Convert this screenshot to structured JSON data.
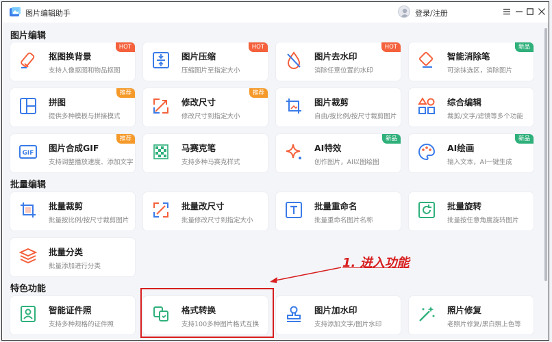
{
  "app": {
    "title": "图片编辑助手",
    "login_label": "登录/注册"
  },
  "colors": {
    "accent": "#3a7be8",
    "hot": "#f4613c",
    "recommend": "#f59a2a",
    "new": "#2fb07b",
    "annotation": "#d81e1e"
  },
  "sections": [
    {
      "title": "图片编辑",
      "cards": [
        {
          "name": "抠图换背景",
          "desc": "支持人像抠图和物品抠图",
          "badge": "HOT",
          "badge_type": "hot",
          "icon": "eraser-icon"
        },
        {
          "name": "图片压缩",
          "desc": "压缩图片至指定大小",
          "badge": "HOT",
          "badge_type": "hot",
          "icon": "compress-icon"
        },
        {
          "name": "图片去水印",
          "desc": "消除任意位置的水印",
          "badge": "HOT",
          "badge_type": "hot",
          "icon": "water-drop-icon"
        },
        {
          "name": "智能消除笔",
          "desc": "可涂抹选区，消除图片",
          "badge": "新品",
          "badge_type": "new",
          "icon": "eraser-pen-icon"
        },
        {
          "name": "拼图",
          "desc": "提供多种模板与拼接模式",
          "badge": "推荐",
          "badge_type": "rec",
          "icon": "collage-icon"
        },
        {
          "name": "修改尺寸",
          "desc": "修改尺寸到指定大小",
          "badge": "推荐",
          "badge_type": "rec",
          "icon": "resize-icon"
        },
        {
          "name": "图片裁剪",
          "desc": "自由/按比例/按尺寸裁剪图片",
          "badge": "",
          "badge_type": "",
          "icon": "crop-icon"
        },
        {
          "name": "综合编辑",
          "desc": "裁剪/文字/滤镜等多个功能",
          "badge": "",
          "badge_type": "",
          "icon": "shapes-icon"
        },
        {
          "name": "图片合成GIF",
          "desc": "支持调整播放速度、添加文字",
          "badge": "推荐",
          "badge_type": "rec",
          "icon": "gif-icon"
        },
        {
          "name": "马赛克笔",
          "desc": "支持多种马赛克样式",
          "badge": "",
          "badge_type": "",
          "icon": "mosaic-icon"
        },
        {
          "name": "AI特效",
          "desc": "创作图片，AI以图绘图",
          "badge": "新品",
          "badge_type": "new",
          "icon": "sparkle-icon"
        },
        {
          "name": "AI绘画",
          "desc": "输入文本，AI一键生成",
          "badge": "新品",
          "badge_type": "new",
          "icon": "palette-icon"
        }
      ]
    },
    {
      "title": "批量编辑",
      "cards": [
        {
          "name": "批量裁剪",
          "desc": "批量按比例/按尺寸裁剪图片",
          "badge": "",
          "badge_type": "",
          "icon": "batch-crop-icon"
        },
        {
          "name": "批量改尺寸",
          "desc": "批量修改尺寸到指定大小",
          "badge": "",
          "badge_type": "",
          "icon": "batch-resize-icon"
        },
        {
          "name": "批量重命名",
          "desc": "批量重命名图片名称",
          "badge": "",
          "badge_type": "",
          "icon": "rename-icon"
        },
        {
          "name": "批量旋转",
          "desc": "批量按任意角度旋转图片",
          "badge": "",
          "badge_type": "",
          "icon": "rotate-icon"
        },
        {
          "name": "批量分类",
          "desc": "批量添加进行分类",
          "badge": "",
          "badge_type": "",
          "icon": "layers-icon"
        }
      ]
    },
    {
      "title": "特色功能",
      "cards": [
        {
          "name": "智能证件照",
          "desc": "支持多种规格的证件照",
          "badge": "",
          "badge_type": "",
          "icon": "id-photo-icon"
        },
        {
          "name": "格式转换",
          "desc": "支持100多种图片格式互换",
          "badge": "",
          "badge_type": "",
          "icon": "format-convert-icon"
        },
        {
          "name": "图片加水印",
          "desc": "支持添加文字/图片水印",
          "badge": "",
          "badge_type": "",
          "icon": "stamp-icon"
        },
        {
          "name": "照片修复",
          "desc": "老照片修复/黑白照上色等",
          "badge": "",
          "badge_type": "",
          "icon": "magic-wand-icon"
        }
      ]
    }
  ],
  "annotation": {
    "text": "1. 进入功能"
  }
}
